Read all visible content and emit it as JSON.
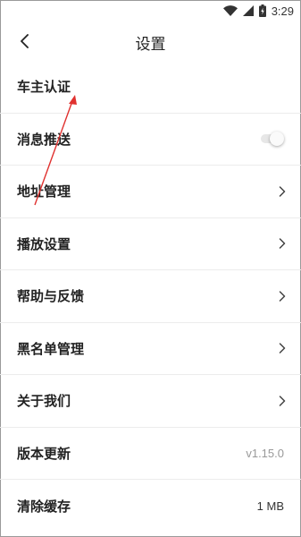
{
  "status_bar": {
    "time": "3:29"
  },
  "header": {
    "title": "设置",
    "back_icon": "back-arrow-icon"
  },
  "settings": {
    "items": [
      {
        "label": "车主认证",
        "control": "none"
      },
      {
        "label": "消息推送",
        "control": "toggle",
        "toggle_on": false
      },
      {
        "label": "地址管理",
        "control": "chevron"
      },
      {
        "label": "播放设置",
        "control": "chevron"
      },
      {
        "label": "帮助与反馈",
        "control": "chevron"
      },
      {
        "label": "黑名单管理",
        "control": "chevron"
      },
      {
        "label": "关于我们",
        "control": "chevron"
      },
      {
        "label": "版本更新",
        "control": "value",
        "value": "v1.15.0"
      },
      {
        "label": "清除缓存",
        "control": "value",
        "value": "1 MB"
      }
    ]
  },
  "colors": {
    "annotation_arrow": "#e0312f",
    "divider": "#ececec"
  }
}
